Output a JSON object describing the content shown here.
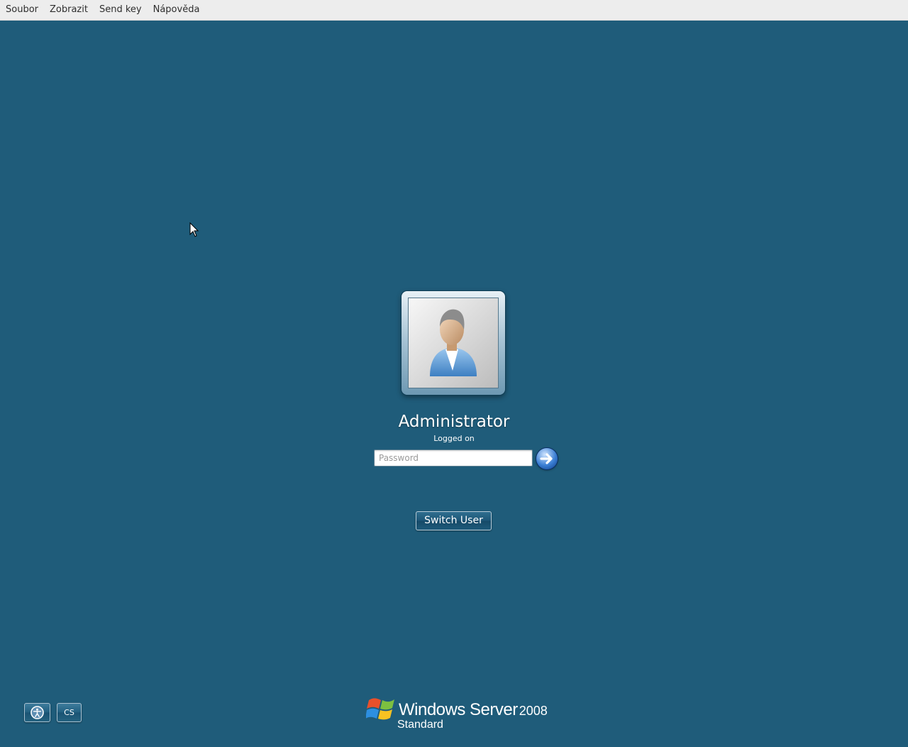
{
  "menubar": {
    "items": [
      "Soubor",
      "Zobrazit",
      "Send key",
      "Nápověda"
    ]
  },
  "login": {
    "username": "Administrator",
    "status": "Logged on",
    "password_placeholder": "Password",
    "password_value": "",
    "switch_user_label": "Switch User"
  },
  "bottom_bar": {
    "language_label": "CS"
  },
  "brand": {
    "name": "Windows Server",
    "year": "2008",
    "edition": "Standard"
  },
  "icons": {
    "avatar": "user-avatar-icon",
    "submit": "arrow-right-icon",
    "ease_of_access": "ease-of-access-icon",
    "logo": "windows-flag-icon"
  },
  "colors": {
    "background": "#1f5c7a",
    "menubar": "#ededed"
  }
}
